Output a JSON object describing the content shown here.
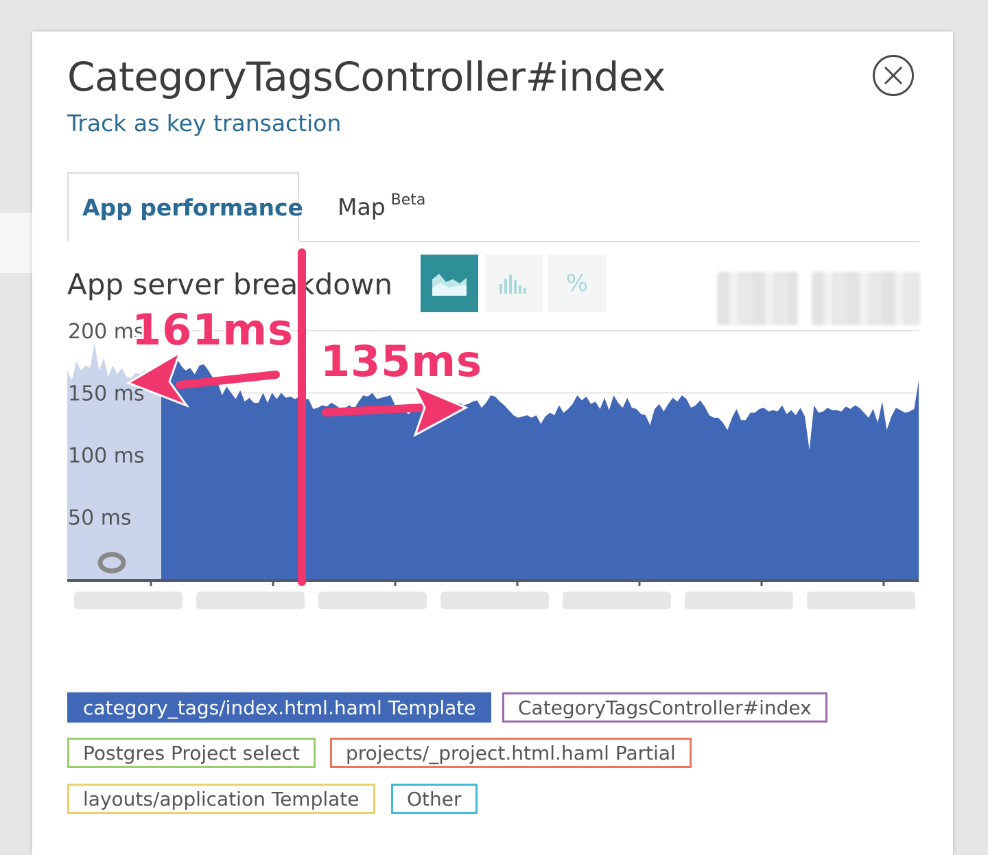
{
  "header": {
    "title": "CategoryTagsController#index",
    "track_link": "Track as key transaction",
    "close_icon": "close-icon"
  },
  "tabs": [
    {
      "label": "App performance",
      "active": true
    },
    {
      "label": "Map",
      "badge": "Beta",
      "active": false
    }
  ],
  "section": {
    "title": "App server breakdown",
    "view_buttons": [
      {
        "icon": "area-chart-icon",
        "active": true
      },
      {
        "icon": "bar-chart-icon",
        "active": false
      },
      {
        "label": "%",
        "active": false
      }
    ]
  },
  "annotations": {
    "before": "161ms",
    "after": "135ms"
  },
  "colors": {
    "series_main": "#4167b7",
    "series_highlight": "#c9d4ea",
    "annotation": "#f0366d",
    "link": "#2a6b96",
    "tab_active": "#2a6b96",
    "view_btn_active": "#2f8f98"
  },
  "chart_data": {
    "type": "area",
    "title": "App server breakdown",
    "ylabel": "",
    "ylim": [
      0,
      200
    ],
    "yticks": [
      "200 ms",
      "150 ms",
      "100 ms",
      "50 ms"
    ],
    "ytick_values": [
      200,
      150,
      100,
      50
    ],
    "grid": true,
    "legend_placement": "bottom",
    "series": [
      {
        "name": "category_tags/index.html.haml Template",
        "values": [
          168,
          160,
          175,
          168,
          172,
          170,
          190,
          168,
          178,
          163,
          172,
          165,
          170,
          163,
          162,
          166,
          165,
          168,
          163,
          165,
          170,
          168,
          172,
          165,
          178,
          172,
          168,
          170,
          165,
          172,
          173,
          168,
          162,
          159,
          148,
          155,
          150,
          145,
          152,
          143,
          146,
          142,
          142,
          150,
          142,
          150,
          145,
          150,
          146,
          147,
          145,
          147,
          145,
          145,
          137,
          138,
          140,
          139,
          142,
          140,
          137,
          138,
          140,
          137,
          143,
          148,
          147,
          150,
          145,
          146,
          147,
          148,
          140,
          137,
          135,
          133,
          136,
          138,
          134,
          138,
          130,
          135,
          136,
          134,
          135,
          138,
          142,
          140,
          141,
          143,
          144,
          138,
          142,
          148,
          147,
          143,
          140,
          136,
          132,
          130,
          131,
          132,
          130,
          132,
          125,
          131,
          134,
          132,
          140,
          134,
          137,
          141,
          148,
          144,
          147,
          141,
          143,
          137,
          146,
          136,
          148,
          142,
          138,
          146,
          138,
          137,
          133,
          132,
          124,
          137,
          141,
          135,
          141,
          146,
          143,
          148,
          145,
          138,
          140,
          144,
          139,
          132,
          130,
          130,
          126,
          120,
          130,
          137,
          128,
          128,
          134,
          134,
          137,
          138,
          135,
          136,
          135,
          140,
          133,
          136,
          132,
          138,
          131,
          104,
          140,
          134,
          135,
          138,
          136,
          136,
          135,
          139,
          137,
          140,
          138,
          134,
          130,
          137,
          126,
          143,
          120,
          131,
          138,
          136,
          134,
          135,
          137,
          160
        ]
      }
    ],
    "legend": [
      {
        "label": "category_tags/index.html.haml Template",
        "color": "#4167b7",
        "filled": true
      },
      {
        "label": "CategoryTagsController#index",
        "color": "#9b6ab0",
        "filled": false
      },
      {
        "label": "Postgres Project select",
        "color": "#9ccc6e",
        "filled": false
      },
      {
        "label": "projects/_project.html.haml Partial",
        "color": "#e8775c",
        "filled": false
      },
      {
        "label": "layouts/application Template",
        "color": "#ecd06c",
        "filled": false
      },
      {
        "label": "Other",
        "color": "#43b9d8",
        "filled": false
      }
    ]
  }
}
